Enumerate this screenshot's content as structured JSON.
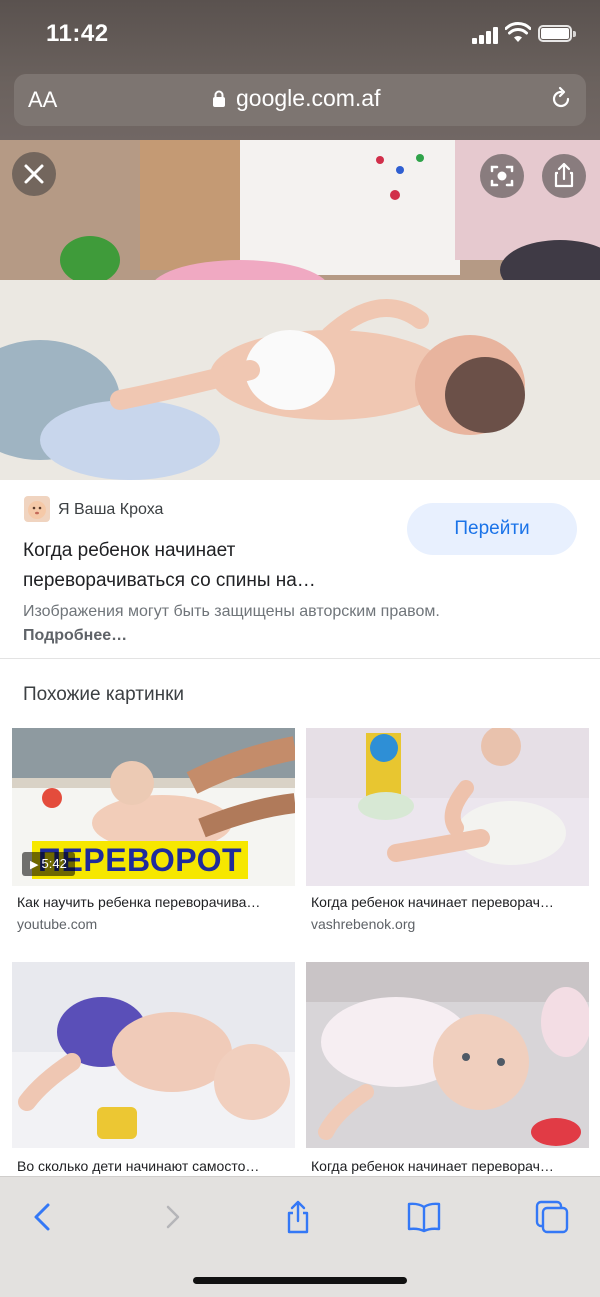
{
  "status_bar": {
    "time": "11:42"
  },
  "url_bar": {
    "text_size_label": "AA",
    "domain": "google.com.af"
  },
  "result": {
    "source_name": "Я Ваша Кроха",
    "go_button_label": "Перейти",
    "title": "Когда ребенок начинает переворачиваться со спины на…",
    "copyright_text": "Изображения могут быть защищены авторским правом.",
    "copyright_link": "Подробнее…"
  },
  "related": {
    "section_title": "Похожие картинки",
    "items": [
      {
        "caption": "Как научить ребенка переворачива…",
        "source": "youtube.com",
        "duration": "5:42",
        "overlay_text": "ПЕРЕВОРОТ"
      },
      {
        "caption": "Когда ребенок начинает переворач…",
        "source": "vashrebenok.org"
      },
      {
        "caption": "Во сколько дети начинают самосто…",
        "source": ""
      },
      {
        "caption": "Когда ребенок начинает переворач…",
        "source": ""
      }
    ]
  },
  "toolbar": {
    "icons": [
      "back-icon",
      "forward-icon",
      "share-icon",
      "bookmarks-icon",
      "tabs-icon"
    ]
  },
  "colors": {
    "accent": "#1a73e8",
    "go_bg": "#e8f0fe",
    "toolbar_bg": "#e3e1df"
  }
}
